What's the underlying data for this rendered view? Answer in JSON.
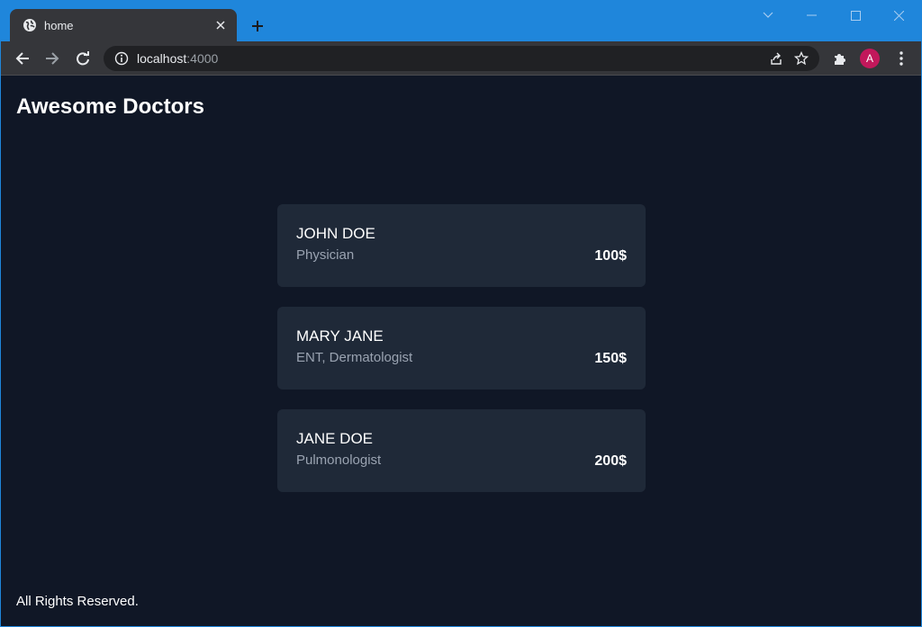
{
  "browser": {
    "tab_title": "home",
    "url_host": "localhost",
    "url_port": ":4000",
    "avatar_letter": "A"
  },
  "page": {
    "title": "Awesome Doctors",
    "doctors": [
      {
        "name": "JOHN DOE",
        "specialty": "Physician",
        "price": "100$"
      },
      {
        "name": "MARY JANE",
        "specialty": "ENT, Dermatologist",
        "price": "150$"
      },
      {
        "name": "JANE DOE",
        "specialty": "Pulmonologist",
        "price": "200$"
      }
    ],
    "footer": "All Rights Reserved."
  },
  "colors": {
    "titlebar": "#1f86db",
    "page_background": "#101726",
    "card_background": "#1f2938",
    "specialty_text": "#9aa3b1",
    "avatar": "#c2185b"
  },
  "icons": [
    "globe-icon",
    "close-icon",
    "plus-icon",
    "chevron-down-icon",
    "minimize-icon",
    "maximize-icon",
    "back-icon",
    "forward-icon",
    "reload-icon",
    "info-icon",
    "share-icon",
    "star-icon",
    "puzzle-icon",
    "kebab-menu-icon"
  ]
}
